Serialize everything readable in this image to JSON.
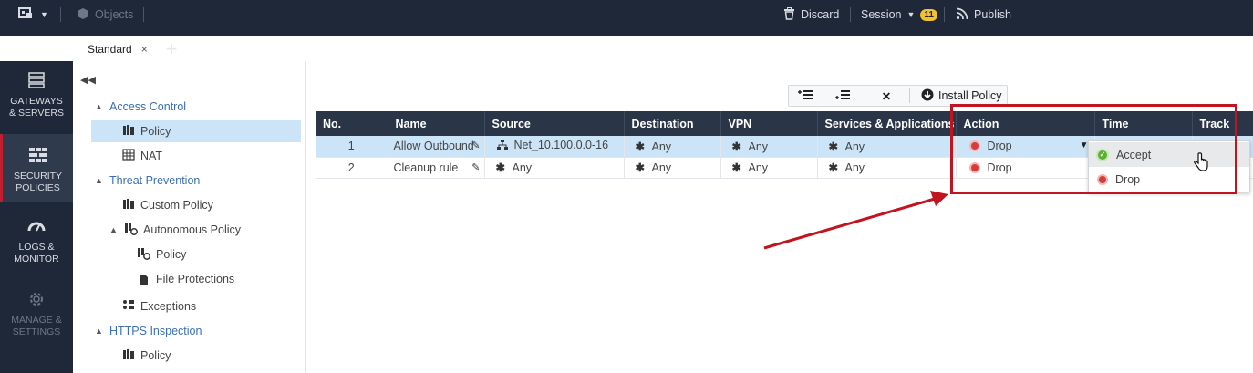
{
  "topbar": {
    "menu_icon": "app-menu-icon",
    "objects_label": "Objects",
    "discard_label": "Discard",
    "session_label": "Session",
    "session_count": "11",
    "publish_label": "Publish"
  },
  "tabs": [
    {
      "label": "Standard",
      "close": "×"
    }
  ],
  "tab_add": "+",
  "leftnav": [
    {
      "line1": "GATEWAYS",
      "line2": "& SERVERS",
      "icon": "gateways-icon"
    },
    {
      "line1": "SECURITY",
      "line2": "POLICIES",
      "icon": "security-policies-icon"
    },
    {
      "line1": "LOGS &",
      "line2": "MONITOR",
      "icon": "logs-gauge-icon"
    },
    {
      "line1": "MANAGE &",
      "line2": "SETTINGS",
      "icon": "gear-icon"
    }
  ],
  "tree": {
    "collapse": "◀◀",
    "items": [
      {
        "label": "Access Control",
        "type": "group"
      },
      {
        "label": "Policy",
        "type": "leaf",
        "selected": true
      },
      {
        "label": "NAT",
        "type": "leaf"
      },
      {
        "label": "Threat Prevention",
        "type": "group"
      },
      {
        "label": "Custom Policy",
        "type": "leaf"
      },
      {
        "label": "Autonomous Policy",
        "type": "subgroup"
      },
      {
        "label": "Policy",
        "type": "leaf2"
      },
      {
        "label": "File Protections",
        "type": "leaf2"
      },
      {
        "label": "Exceptions",
        "type": "leaf"
      },
      {
        "label": "HTTPS Inspection",
        "type": "group"
      },
      {
        "label": "Policy",
        "type": "leaf"
      }
    ]
  },
  "toolbar": {
    "add_above_icon": "add-rule-above-icon",
    "add_below_icon": "add-rule-below-icon",
    "delete_label": "✕",
    "install_label": "Install Policy"
  },
  "table": {
    "columns": [
      "No.",
      "Name",
      "Source",
      "Destination",
      "VPN",
      "Services & Applications",
      "Action",
      "Time",
      "Track"
    ],
    "rows": [
      {
        "no": "1",
        "name": "Allow Outbound",
        "source": "Net_10.100.0.0-16",
        "destination": "Any",
        "vpn": "Any",
        "services": "Any",
        "action": "Drop",
        "time": "",
        "track": "ne"
      },
      {
        "no": "2",
        "name": "Cleanup rule",
        "source": "Any",
        "destination": "Any",
        "vpn": "Any",
        "services": "Any",
        "action": "Drop",
        "time": "",
        "track": ""
      }
    ]
  },
  "action_dropdown": {
    "options": [
      "Accept",
      "Drop"
    ],
    "hovered": "Accept"
  },
  "colors": {
    "header_bg": "#2a3548",
    "nav_bg": "#1f2838",
    "selection": "#cce4f7",
    "annotation_red": "#c0141e",
    "accept_green": "#5bb031",
    "drop_red": "#d63c3c"
  }
}
